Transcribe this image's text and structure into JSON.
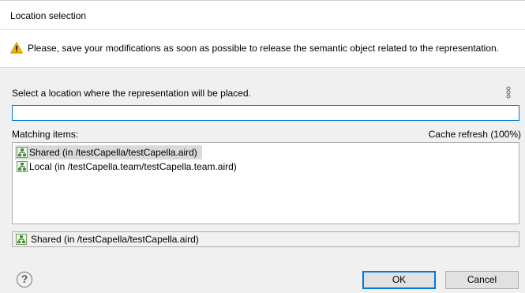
{
  "window": {
    "title": "Location selection"
  },
  "message": {
    "text": "Please, save your modifications as soon as possible to release the semantic object related to the representation.",
    "icon": "warning-icon"
  },
  "select_label": "Select a location where the representation will be placed.",
  "filter": {
    "value": "",
    "placeholder": ""
  },
  "matching_label": "Matching items:",
  "cache_status": "Cache refresh (100%)",
  "items": [
    {
      "label": "Shared (in /testCapella/testCapella.aird)",
      "selected": true,
      "icon": "session-icon"
    },
    {
      "label": "Local (in /testCapella.team/testCapella.team.aird)",
      "selected": false,
      "icon": "session-icon"
    }
  ],
  "detail": {
    "label": "Shared (in /testCapella/testCapella.aird)",
    "icon": "session-icon"
  },
  "buttons": {
    "ok": "OK",
    "cancel": "Cancel",
    "help": "?"
  },
  "colors": {
    "accent": "#0078d7",
    "warning": "#f3b200",
    "selection": "#d9d9d9"
  }
}
